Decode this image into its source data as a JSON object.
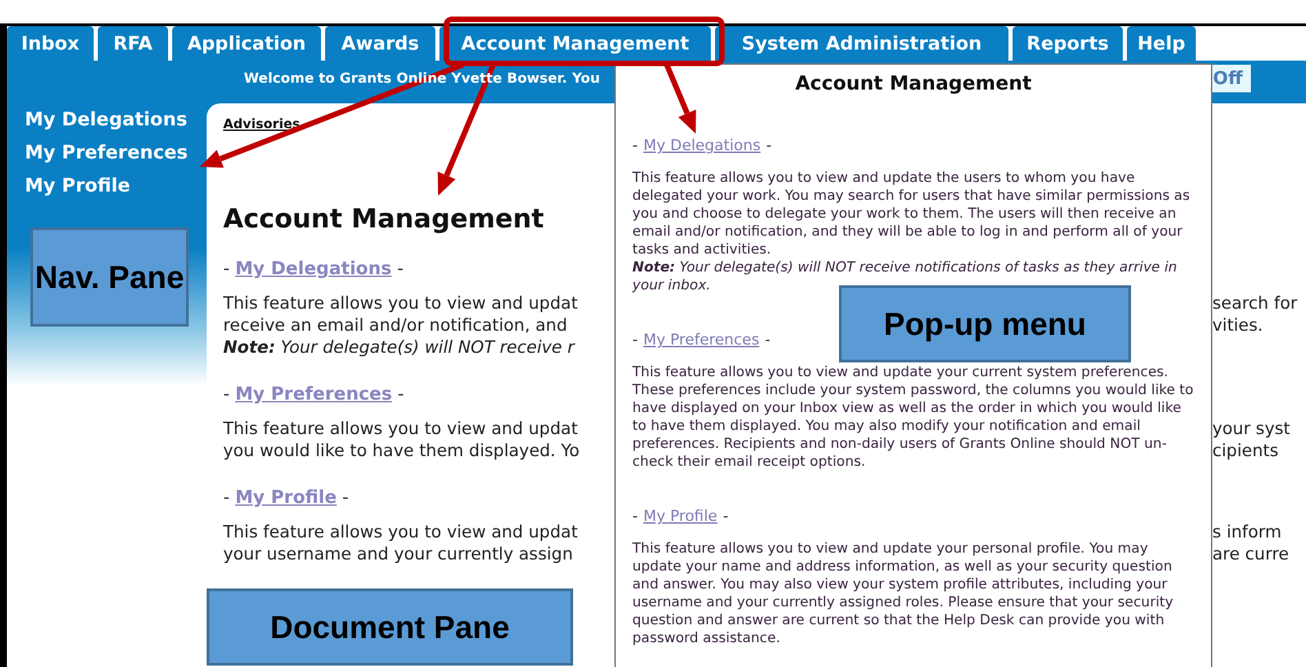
{
  "tabs": [
    {
      "label": "Inbox"
    },
    {
      "label": "RFA"
    },
    {
      "label": "Application"
    },
    {
      "label": "Awards"
    },
    {
      "label": "Account Management"
    },
    {
      "label": "System Administration"
    },
    {
      "label": "Reports"
    },
    {
      "label": "Help"
    }
  ],
  "banner": {
    "welcome": "Welcome to Grants Online Yvette Bowser. You",
    "button": "Off"
  },
  "nav": {
    "items": [
      "My Delegations",
      "My Preferences",
      "My Profile"
    ]
  },
  "document": {
    "tab": "Advisories",
    "heading": "Account Management",
    "sections": [
      {
        "before": "-",
        "link": "My Delegations",
        "after": "-",
        "lines": [
          {
            "left": "This feature allows you to view and updat",
            "right": "search for"
          },
          {
            "left": "receive an email and/or notification, and",
            "right": "vities."
          },
          {
            "left": "**Note:** Your delegate(s) will NOT receive r",
            "note": true
          }
        ]
      },
      {
        "before": "-",
        "link": "My Preferences",
        "after": "-",
        "lines": [
          {
            "left": "This feature allows you to view and updat",
            "right": "your syst"
          },
          {
            "left": "you would like to have them displayed. Yo",
            "right": "cipients"
          }
        ]
      },
      {
        "before": "-",
        "link": "My Profile",
        "after": "-",
        "lines": [
          {
            "left": "This feature allows you to view and updat",
            "right": "s inform"
          },
          {
            "left": "your username and your currently assign",
            "right": "are curre"
          }
        ]
      }
    ]
  },
  "popup": {
    "title": "Account Management",
    "sections": [
      {
        "before": "-",
        "link": "My Delegations",
        "after": "-",
        "text": "This feature allows you to view and update the users to whom you have delegated your work. You may search for users that have similar permissions as you and choose to delegate your work to them. The users will then receive an email and/or notification, and they will be able to log in and perform all of your tasks and activities.",
        "note": "**Note:** Your delegate(s) will NOT receive notifications of tasks as they arrive in your inbox."
      },
      {
        "before": "-",
        "link": "My Preferences",
        "after": "-",
        "text": "This feature allows you to view and update your current system preferences. These preferences include your system password, the columns you would like to have displayed on your Inbox view as well as the order in which you would like to have them displayed. You may also modify your notification and email preferences. Recipients and non-daily users of Grants Online should NOT un-check their email receipt options."
      },
      {
        "before": "-",
        "link": "My Profile",
        "after": "-",
        "text": "This feature allows you to view and update your personal profile. You may update your name and address information, as well as your security question and answer. You may also view your system profile attributes, including your username and your currently assigned roles. Please ensure that your security question and answer are current so that the Help Desk can provide you with password assistance."
      }
    ]
  },
  "callouts": [
    {
      "kind": "nav",
      "text": "Nav. Pane"
    },
    {
      "kind": "document",
      "text": "Document Pane"
    },
    {
      "kind": "popup",
      "text": "Pop-up menu"
    }
  ]
}
